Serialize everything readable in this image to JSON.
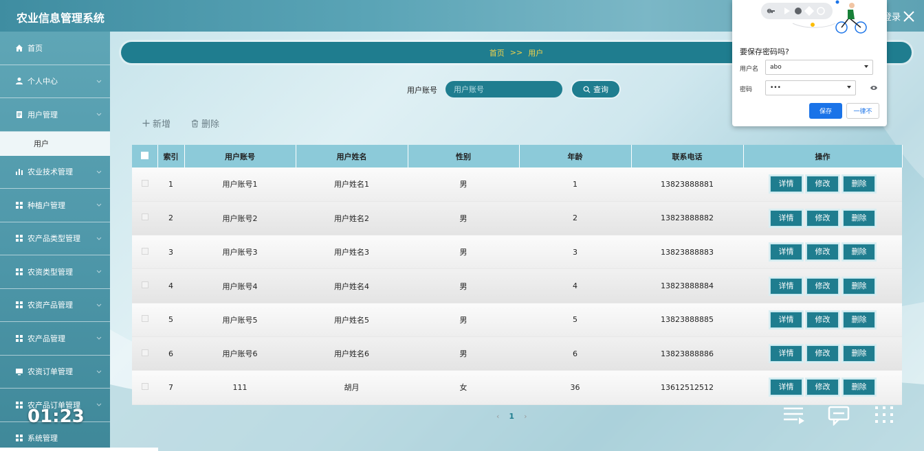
{
  "app": {
    "title": "农业信息管理系统",
    "login_link": "登录"
  },
  "sidebar": {
    "items": [
      {
        "label": "首页",
        "icon": "home-icon",
        "has_chevron": false
      },
      {
        "label": "个人中心",
        "icon": "user-icon",
        "has_chevron": true
      },
      {
        "label": "用户管理",
        "icon": "document-icon",
        "has_chevron": true
      },
      {
        "label": "农业技术管理",
        "icon": "bar-chart-icon",
        "has_chevron": true
      },
      {
        "label": "种植户管理",
        "icon": "grid-icon",
        "has_chevron": true
      },
      {
        "label": "农产品类型管理",
        "icon": "grid-icon",
        "has_chevron": true
      },
      {
        "label": "农资类型管理",
        "icon": "grid-icon",
        "has_chevron": true
      },
      {
        "label": "农资产品管理",
        "icon": "grid-icon",
        "has_chevron": true
      },
      {
        "label": "农产品管理",
        "icon": "grid-icon",
        "has_chevron": true
      },
      {
        "label": "农资订单管理",
        "icon": "monitor-icon",
        "has_chevron": true
      },
      {
        "label": "农产品订单管理",
        "icon": "grid-icon",
        "has_chevron": true
      },
      {
        "label": "系统管理",
        "icon": "grid-icon",
        "has_chevron": true
      }
    ],
    "submenu": {
      "parent_index": 2,
      "label": "用户"
    }
  },
  "breadcrumb": {
    "home": "首页",
    "separator": ">>",
    "current": "用户"
  },
  "search": {
    "label": "用户账号",
    "placeholder": "用户账号",
    "value": "",
    "button_label": "查询"
  },
  "actions": {
    "add_label": "新增",
    "delete_label": "删除"
  },
  "table": {
    "columns": [
      "索引",
      "用户账号",
      "用户姓名",
      "性别",
      "年龄",
      "联系电话",
      "操作"
    ],
    "rows": [
      {
        "index": "1",
        "account": "用户账号1",
        "name": "用户姓名1",
        "gender": "男",
        "age": "1",
        "phone": "13823888881"
      },
      {
        "index": "2",
        "account": "用户账号2",
        "name": "用户姓名2",
        "gender": "男",
        "age": "2",
        "phone": "13823888882"
      },
      {
        "index": "3",
        "account": "用户账号3",
        "name": "用户姓名3",
        "gender": "男",
        "age": "3",
        "phone": "13823888883"
      },
      {
        "index": "4",
        "account": "用户账号4",
        "name": "用户姓名4",
        "gender": "男",
        "age": "4",
        "phone": "13823888884"
      },
      {
        "index": "5",
        "account": "用户账号5",
        "name": "用户姓名5",
        "gender": "男",
        "age": "5",
        "phone": "13823888885"
      },
      {
        "index": "6",
        "account": "用户账号6",
        "name": "用户姓名6",
        "gender": "男",
        "age": "6",
        "phone": "13823888886"
      },
      {
        "index": "7",
        "account": "111",
        "name": "胡月",
        "gender": "女",
        "age": "36",
        "phone": "13612512512"
      }
    ],
    "row_buttons": {
      "detail": "详情",
      "edit": "修改",
      "delete": "删除"
    }
  },
  "pagination": {
    "prev": "‹",
    "current": "1",
    "next": "›"
  },
  "video_overlay": {
    "time": "01:23"
  },
  "password_popup": {
    "title": "要保存密码吗?",
    "username_label": "用户名",
    "username_value": "abo",
    "password_label": "密码",
    "password_value": "•••",
    "save_label": "保存",
    "never_label": "一律不"
  },
  "colors": {
    "accent": "#1f7d8f",
    "breadcrumb_text": "#f5d44a",
    "header_cell": "#8ccad9",
    "popup_primary": "#1a73e8"
  }
}
